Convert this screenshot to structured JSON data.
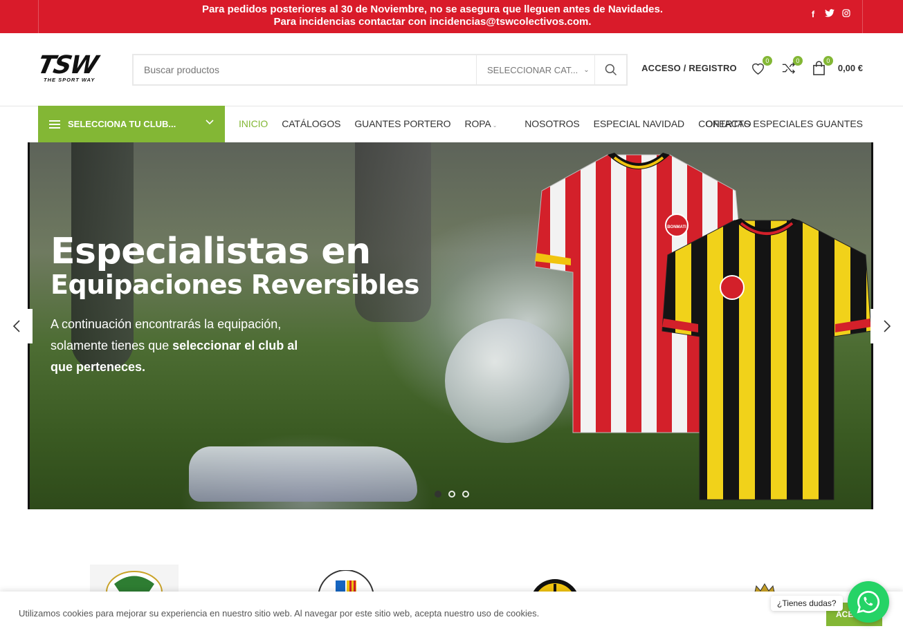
{
  "topbar": {
    "line1": "Para pedidos posteriores al 30 de Noviembre, no se asegura que lleguen antes de Navidades.",
    "line2": "Para incidencias contactar con incidencias@tswcolectivos.com.",
    "social": [
      "f",
      "twitter",
      "instagram"
    ]
  },
  "header": {
    "logo_mark": "TSW",
    "logo_sub": "THE SPORT WAY",
    "search_placeholder": "Buscar productos",
    "category_label": "SELECCIONAR CAT...",
    "account_label": "ACCESO / REGISTRO",
    "wishlist_count": "0",
    "compare_count": "0",
    "cart_count": "0",
    "cart_total": "0,00 €"
  },
  "nav": {
    "club_selector": "SELECCIONA TU CLUB...",
    "items": [
      "INICIO",
      "CATÁLOGOS",
      "GUANTES PORTERO",
      "ROPA",
      "NOSOTROS",
      "ESPECIAL NAVIDAD",
      "CONTACTO"
    ],
    "right_item": "OFERTAS ESPECIALES GUANTES"
  },
  "hero": {
    "title_line1": "Especialistas en",
    "title_line2": "Equipaciones Reversibles",
    "desc_plain": "A continuación encontrarás la equipación, solamente tienes que ",
    "desc_bold": "seleccionar el club al que perteneces.",
    "slides": 3,
    "active_slide": 1,
    "jersey_brand": "BONMATI"
  },
  "cookie": {
    "text": "Utilizamos cookies para mejorar su experiencia en nuestro sitio web. Al navegar por este sitio web, acepta nuestro uso de cookies.",
    "accept": "ACEPTAR"
  },
  "whatsapp": {
    "tooltip": "¿Tienes dudas?"
  },
  "colors": {
    "topbar": "#d91b2a",
    "accent_green": "#83b735",
    "whatsapp": "#25d366"
  }
}
